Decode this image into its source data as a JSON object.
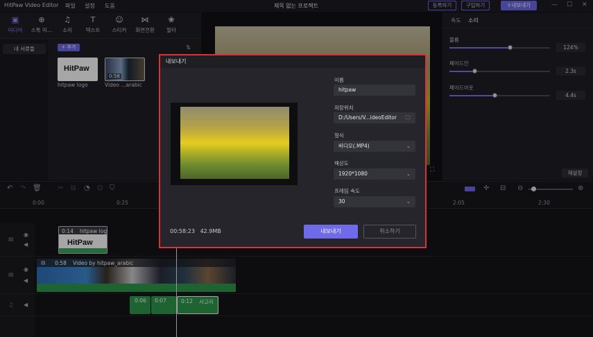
{
  "titlebar": {
    "app_name": "HitPaw Video Editor",
    "menu": [
      "파일",
      "설정",
      "도움"
    ],
    "project_title": "제목 없는 프로젝트",
    "register_label": "등록하기",
    "buy_label": "구입하기",
    "export_label": "내보내기"
  },
  "toolbar": {
    "tools": [
      {
        "label": "미디어",
        "icon": "media-icon"
      },
      {
        "label": "스톡 미...",
        "icon": "globe-icon"
      },
      {
        "label": "소리",
        "icon": "music-icon"
      },
      {
        "label": "텍스트",
        "icon": "text-icon"
      },
      {
        "label": "스티커",
        "icon": "sticker-icon"
      },
      {
        "label": "화면전환",
        "icon": "transition-icon"
      },
      {
        "label": "필터",
        "icon": "filter-icon"
      }
    ]
  },
  "media": {
    "library_label": "내 서류들",
    "add_label": "+ 추가",
    "items": [
      {
        "name": "hitpaw logo",
        "logo_text": "HitPaw"
      },
      {
        "name": "Video ...arabic",
        "duration": "0:58"
      }
    ]
  },
  "right_panel": {
    "tabs": [
      "속도",
      "소리"
    ],
    "active_tab": "소리",
    "volume_label": "볼륨",
    "volume_value": "124%",
    "volume_level": 0.6,
    "fade_in_label": "페이드인",
    "fade_in_value": "2.3s",
    "fade_in_level": 0.25,
    "fade_out_label": "페이드아웃",
    "fade_out_value": "4.4s",
    "fade_out_level": 0.45,
    "reset_label": "재설정"
  },
  "timeline": {
    "ruler": [
      "0:00",
      "0:25",
      "2:05",
      "2:30"
    ],
    "clips": {
      "logo": {
        "duration": "0:14",
        "name": "hitpaw logo"
      },
      "video": {
        "duration": "0:58",
        "name": "Video by hitpaw_arabic"
      },
      "audio": [
        {
          "duration": "0:06"
        },
        {
          "duration": "0:07"
        },
        {
          "duration": "0:12",
          "name": "사고리"
        }
      ]
    }
  },
  "export_dialog": {
    "title": "내보내기",
    "name_label": "이름",
    "name_value": "hitpaw",
    "path_label": "저장위치",
    "path_value": "D:/Users/V...ideoEditor",
    "format_label": "형식",
    "format_value": "비디오(.MP4)",
    "resolution_label": "해상도",
    "resolution_value": "1920*1080",
    "framerate_label": "프레임 속도",
    "framerate_value": "30",
    "duration": "00:58:23",
    "size": "42.9MB",
    "export_label": "내보내기",
    "cancel_label": "취소하기"
  }
}
